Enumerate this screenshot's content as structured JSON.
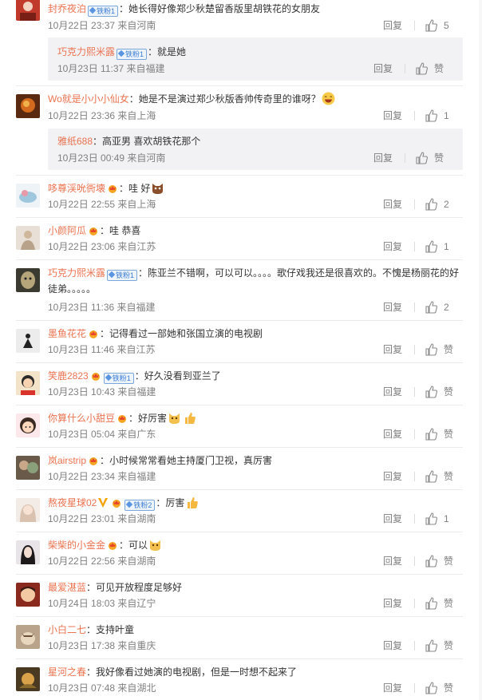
{
  "comments": [
    {
      "user": "封乔夜泊",
      "badge": "铁粉1",
      "text": "：她长得好像郑少秋楚留香版里胡铁花的女朋友",
      "time": "10月22日 23:37 来自河南",
      "reply": "回复",
      "likes": "5",
      "sub": {
        "user": "巧克力熙米露",
        "badge": "铁粉1",
        "text": "：就是她",
        "time": "10月23日 11:37 来自福建",
        "reply": "回复",
        "likes": "赞"
      }
    },
    {
      "user": "Wo就是小小小仙女",
      "text": "：她是不是演过郑少秋版香帅传奇里的谁呀？",
      "time": "10月22日 23:36 来自上海",
      "reply": "回复",
      "likes": "1",
      "sub": {
        "user": "雅纸688",
        "text": "：高亚男 喜欢胡铁花那个",
        "time": "10月23日 00:49 来自河南",
        "reply": "回复",
        "likes": "赞"
      }
    },
    {
      "user": "哆尊渓吮衖壊",
      "vip": true,
      "text": "：哇 好",
      "time": "10月22日 22:55 来自上海",
      "reply": "回复",
      "likes": "2"
    },
    {
      "user": "小颜阿瓜",
      "vip": true,
      "text": "：哇 恭喜",
      "time": "10月22日 23:06 来自江苏",
      "reply": "回复",
      "likes": "1"
    },
    {
      "user": "巧克力熙米露",
      "badge": "铁粉1",
      "text": "：陈亚兰不错啊，可以可以。。。。歌仔戏我还是很喜欢的。不愧是杨丽花的好徒弟。。。。。",
      "time": "10月23日 11:36 来自福建",
      "reply": "回复",
      "likes": "2"
    },
    {
      "user": "墨鱼花花",
      "vip": true,
      "text": "：记得看过一部她和张国立演的电视剧",
      "time": "10月23日 11:46 来自江苏",
      "reply": "回复",
      "likes": "赞"
    },
    {
      "user": "笑鹿2823",
      "vip": true,
      "badge": "铁粉1",
      "text": "：好久没看到亚兰了",
      "time": "10月23日 10:43 来自福建",
      "reply": "回复",
      "likes": "赞"
    },
    {
      "user": "你算什么小甜豆",
      "vip": true,
      "text": "：好厉害",
      "time": "10月23日 05:04 来自广东",
      "reply": "回复",
      "likes": "赞"
    },
    {
      "user": "岚airstrip",
      "vip": true,
      "text": "：小时候常常看她主持厦门卫视，真厉害",
      "time": "10月22日 23:34 来自福建",
      "reply": "回复",
      "likes": "赞"
    },
    {
      "user": "熬夜星球02",
      "vip": true,
      "badge": "铁粉2",
      "text": "：厉害",
      "time": "10月22日 23:01 来自湖南",
      "reply": "回复",
      "likes": "1"
    },
    {
      "user": "柴柴的小金金",
      "vip": true,
      "text": "：可以",
      "time": "10月22日 22:56 来自湖南",
      "reply": "回复",
      "likes": "赞"
    },
    {
      "user": "最爱湛蓝",
      "text": "：可见开放程度足够好",
      "time": "10月24日 18:03 来自辽宁",
      "reply": "回复",
      "likes": "赞"
    },
    {
      "user": "小白二七",
      "text": "：支持叶童",
      "time": "10月23日 17:38 来自重庆",
      "reply": "回复",
      "likes": "赞"
    },
    {
      "user": "星河之春",
      "text": "：我好像看过她演的电视剧，但是一时想不起来了",
      "time": "10月23日 07:48 来自湖北",
      "reply": "回复",
      "likes": "赞"
    }
  ],
  "icons": {
    "like": "thumbs-up-icon",
    "vip": "vip-crown-icon",
    "badge": "iron-fan-badge-icon",
    "emoji": "emoji-icon"
  },
  "colors": {
    "username": "#eb7350",
    "meta": "#808080",
    "badge": "#3b7bd4",
    "subBg": "#f2f2f5"
  }
}
